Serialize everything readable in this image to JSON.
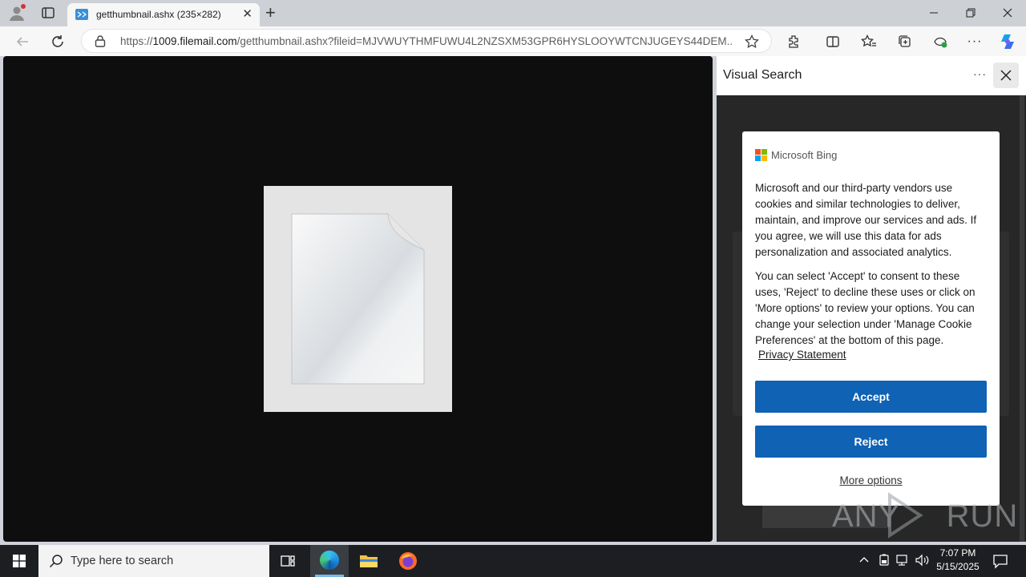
{
  "browser": {
    "tab_title": "getthumbnail.ashx (235×282)",
    "url_prefix": "https://",
    "url_host": "1009.filemail.com",
    "url_path": "/getthumbnail.ashx?fileid=MJVWUYTHMFUWU4L2NZSXM53GPR6HYSLOOYWTCNJUGEYS44DEM..."
  },
  "visual_search": {
    "title": "Visual Search",
    "more_label": "···",
    "brand": "Microsoft Bing",
    "paragraph1": "Microsoft and our third-party vendors use cookies and similar technologies to deliver, maintain, and improve our services and ads. If you agree, we will use this data for ads personalization and associated analytics.",
    "paragraph2": "You can select 'Accept' to consent to these uses, 'Reject' to decline these uses or click on 'More options' to review your options. You can change your selection under 'Manage Cookie Preferences' at the bottom of this page.",
    "privacy_link": "Privacy Statement",
    "accept_label": "Accept",
    "reject_label": "Reject",
    "more_options_label": "More options",
    "accent": "#0f62b4"
  },
  "watermark": {
    "text": "ANY RUN"
  },
  "taskbar": {
    "search_placeholder": "Type here to search",
    "time": "7:07 PM",
    "date": "5/15/2025"
  }
}
